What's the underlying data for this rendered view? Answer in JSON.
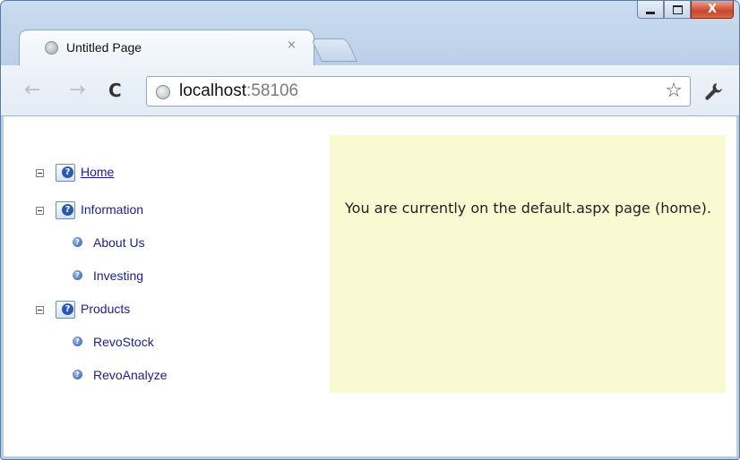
{
  "window": {
    "controls": {
      "minimize": "minimize",
      "maximize": "maximize",
      "close": "X"
    }
  },
  "tab": {
    "title": "Untitled Page",
    "close_glyph": "×",
    "favicon": "globe-icon"
  },
  "toolbar": {
    "back_glyph": "←",
    "forward_glyph": "→",
    "reload_glyph": "C",
    "url_host": "localhost",
    "url_port": ":58106",
    "star_glyph": "☆",
    "wrench_glyph": "🔧"
  },
  "tree": {
    "nodes": [
      {
        "label": "Home",
        "level": 0,
        "expanded": true,
        "selected_link": true
      },
      {
        "label": "Information",
        "level": 0,
        "expanded": true
      },
      {
        "label": "About Us",
        "level": 1
      },
      {
        "label": "Investing",
        "level": 1
      },
      {
        "label": "Products",
        "level": 0,
        "expanded": true
      },
      {
        "label": "RevoStock",
        "level": 1
      },
      {
        "label": "RevoAnalyze",
        "level": 1
      }
    ]
  },
  "panel": {
    "text": "You are currently on the default.aspx page (home).",
    "background": "#fafad2"
  },
  "colors": {
    "link": "#1a1aa6",
    "frame": "#b7cde6"
  }
}
